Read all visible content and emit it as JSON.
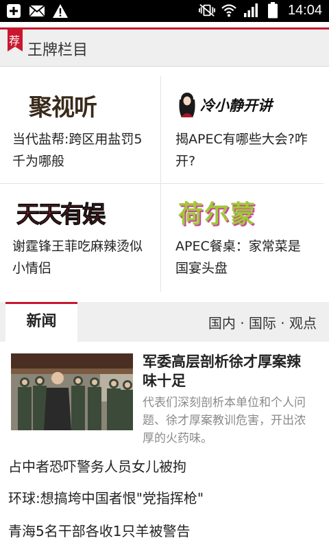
{
  "status_bar": {
    "time": "14:04",
    "left_icons": [
      "add-box-icon",
      "mail-icon",
      "warning-icon"
    ],
    "right_icons": [
      "vibrate-mute-icon",
      "wifi-icon",
      "signal-icon",
      "battery-icon"
    ]
  },
  "columns_section": {
    "badge": "荐",
    "title": "王牌栏目",
    "items": [
      {
        "logo": "聚视听",
        "text": "当代盐帮:跨区用盐罚5千为哪般"
      },
      {
        "logo": "冷小静开讲",
        "text": "揭APEC有哪些大会?咋开?"
      },
      {
        "logo": "天天有娱",
        "text": "谢霆锋王菲吃麻辣烫似小情侣"
      },
      {
        "logo": "荷尔蒙",
        "text": "APEC餐桌：家常菜是国宴头盘"
      }
    ]
  },
  "news_section": {
    "tab_label": "新闻",
    "sub_categories": "国内 · 国际 · 观点",
    "featured": {
      "title": "军委高层剖析徐才厚案辣味十足",
      "description": "代表们深刻剖析本单位和个人问题、徐才厚案教训危害，开出浓厚的火药味。"
    },
    "headlines": [
      "占中者恐吓警务人员女儿被拘",
      "环球:想搞垮中国者恨\"党指挥枪\"",
      "青海5名干部各收1只羊被警告"
    ]
  },
  "colors": {
    "accent_red": "#c8172e",
    "header_bg": "#efefef",
    "status_bar_bg": "#000000"
  }
}
